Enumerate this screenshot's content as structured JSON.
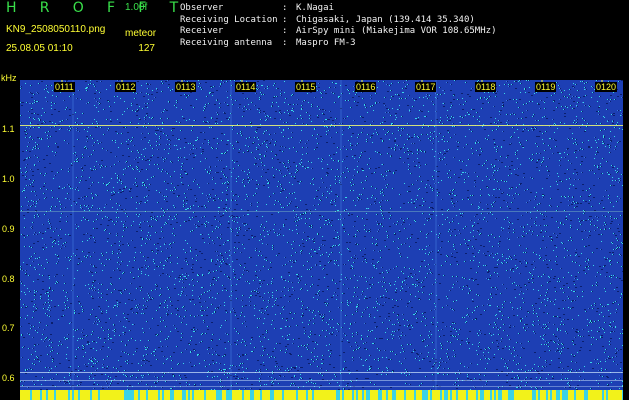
{
  "header": {
    "app_title": "H R O F F T",
    "version": "1.00f",
    "filename": "KN9_2508050110.png",
    "datetime": "25.08.05 01:10",
    "mode": "meteor",
    "count": "127"
  },
  "meta": [
    {
      "label": "Observer",
      "sep": ":",
      "value": "K.Nagai"
    },
    {
      "label": "Receiving Location",
      "sep": ":",
      "value": "Chigasaki, Japan (139.414 35.340)"
    },
    {
      "label": "Receiver",
      "sep": ":",
      "value": "AirSpy mini (Miakejima VOR 108.65MHz)"
    },
    {
      "label": "Receiving antenna",
      "sep": ":",
      "value": "Maspro FM-3"
    }
  ],
  "axis": {
    "unit": "kHz",
    "y_ticks": [
      "1.1",
      "1.0",
      "0.9",
      "0.8",
      "0.7",
      "0.6"
    ],
    "x_ticks": [
      "0111",
      "0112",
      "0113",
      "0114",
      "0115",
      "0116",
      "0117",
      "0118",
      "0119",
      "0120"
    ]
  },
  "colors": {
    "background": "#000000",
    "plot_base": "#1d3fb4",
    "noise_light": "#39d8e8",
    "noise_dark": "#0b1f6e",
    "title_green": "#39e04a",
    "label_yellow": "#ffff33",
    "meta_white": "#f2f2f2"
  }
}
